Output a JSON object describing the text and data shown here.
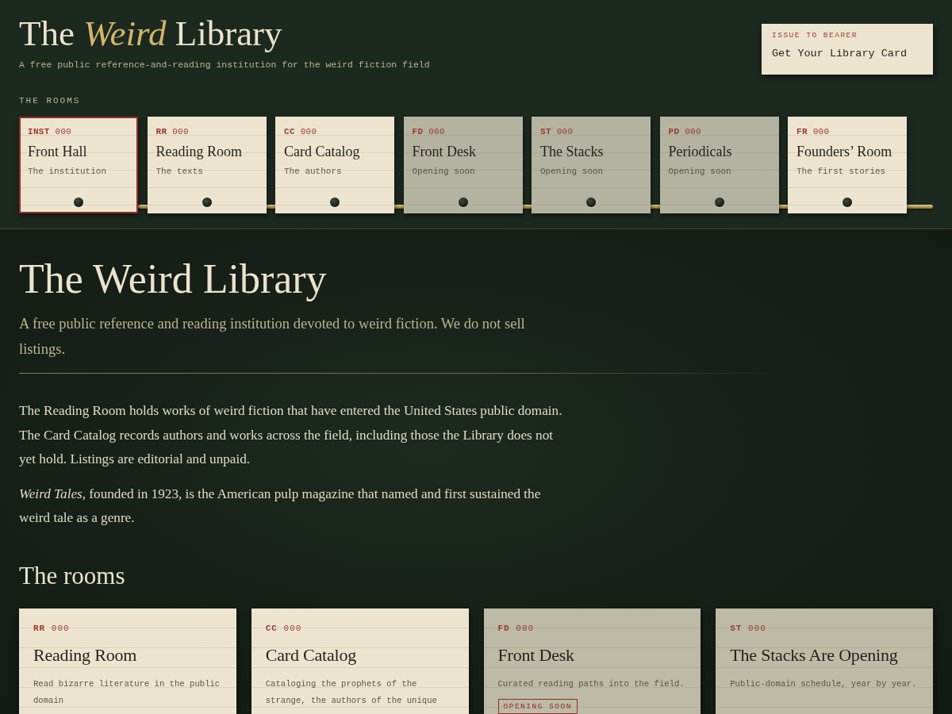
{
  "header": {
    "title": "The *Weird* Library",
    "tagline": "A free public reference-and-reading institution for the weird fiction field",
    "rooms_label": "THE ROOMS"
  },
  "library_card_button": {
    "eyebrow": "ISSUE TO BEARER",
    "label": "Get Your Library Card"
  },
  "room_tabs": [
    {
      "code": "**INST** 000",
      "name": "Front Hall",
      "subtitle": "The institution",
      "selected": true,
      "opening_soon": false
    },
    {
      "code": "**RR** 000",
      "name": "Reading Room",
      "subtitle": "The texts",
      "selected": false,
      "opening_soon": false
    },
    {
      "code": "**CC** 000",
      "name": "Card Catalog",
      "subtitle": "The authors",
      "selected": false,
      "opening_soon": false
    },
    {
      "code": "**FD** 000",
      "name": "Front Desk",
      "subtitle": "Opening soon",
      "selected": false,
      "opening_soon": true
    },
    {
      "code": "**ST** 000",
      "name": "The Stacks",
      "subtitle": "Opening soon",
      "selected": false,
      "opening_soon": true
    },
    {
      "code": "**PD** 000",
      "name": "Periodicals",
      "subtitle": "Opening soon",
      "selected": false,
      "opening_soon": true
    },
    {
      "code": "**FR** 000",
      "name": "Founders’ Room",
      "subtitle": "The first stories",
      "selected": false,
      "opening_soon": false
    }
  ],
  "intro": {
    "heading": "The Weird Library",
    "lead": "A free public reference and reading institution devoted to weird fiction. We do not sell listings.",
    "paragraphs": [
      "The Reading Room holds works of weird fiction that have entered the United States public domain. The Card Catalog records authors and works across the field, including those the Library does not yet hold. Listings are editorial and unpaid.",
      "*Weird Tales*, founded in 1923, is the American pulp magazine that named and first sustained the weird tale as a genre."
    ]
  },
  "rooms_section": {
    "heading": "The rooms",
    "cards": [
      {
        "code": "**RR** 000",
        "title": "Reading Room",
        "description": "Read bizarre literature in the public domain",
        "opening_soon": false
      },
      {
        "code": "**CC** 000",
        "title": "Card Catalog",
        "description": "Cataloging the prophets of the strange, the authors of the unique",
        "opening_soon": false
      },
      {
        "code": "**FD** 000",
        "title": "Front Desk",
        "description": "Curated reading paths into the field.",
        "opening_soon": true,
        "badge": "OPENING SOON"
      },
      {
        "code": "**ST** 000",
        "title": "The Stacks Are Opening",
        "description": "Public-domain schedule, year by year.",
        "opening_soon": true
      }
    ]
  }
}
